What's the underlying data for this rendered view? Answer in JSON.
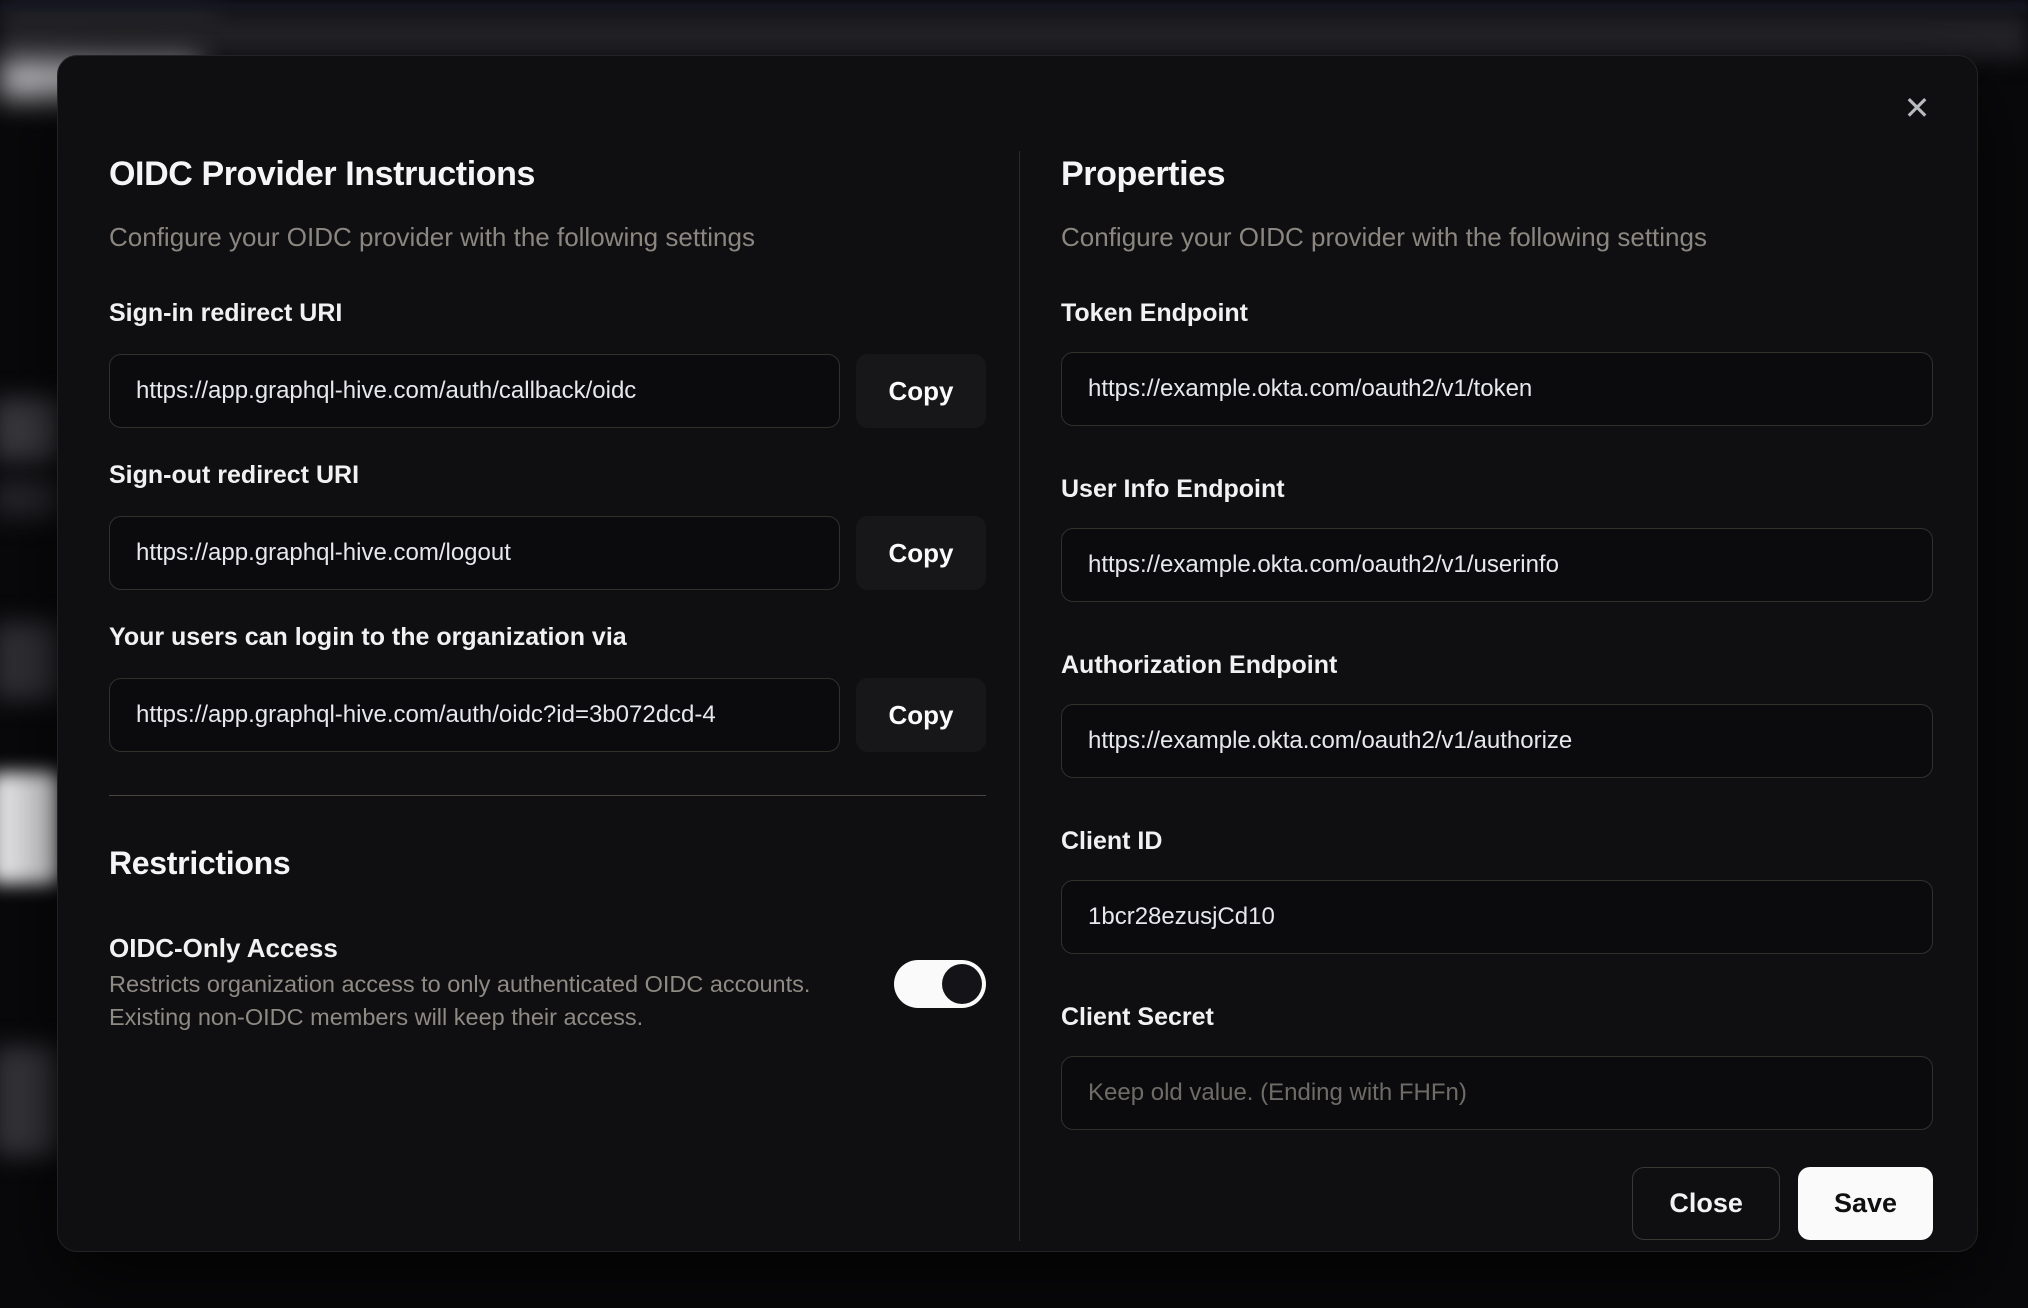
{
  "colors": {
    "modal_bg": "#0f0f12",
    "input_border": "#33302b",
    "accent_button_bg": "#fafafa",
    "toggle_on_track": "#fafafa",
    "toggle_on_knob": "#141418"
  },
  "modal": {
    "close_icon": "✕",
    "left": {
      "title": "OIDC Provider Instructions",
      "subtitle": "Configure your OIDC provider with the following settings",
      "fields": [
        {
          "label": "Sign-in redirect URI",
          "value": "https://app.graphql-hive.com/auth/callback/oidc",
          "copy_label": "Copy"
        },
        {
          "label": "Sign-out redirect URI",
          "value": "https://app.graphql-hive.com/logout",
          "copy_label": "Copy"
        },
        {
          "label": "Your users can login to the organization via",
          "value": "https://app.graphql-hive.com/auth/oidc?id=3b072dcd-4",
          "copy_label": "Copy"
        }
      ],
      "restrictions": {
        "title": "Restrictions",
        "toggle_label": "OIDC-Only Access",
        "toggle_description_line1": "Restricts organization access to only authenticated OIDC accounts.",
        "toggle_description_line2": "Existing non-OIDC members will keep their access.",
        "toggle_state": "on"
      }
    },
    "right": {
      "title": "Properties",
      "subtitle": "Configure your OIDC provider with the following settings",
      "fields": [
        {
          "label": "Token Endpoint",
          "value": "https://example.okta.com/oauth2/v1/token"
        },
        {
          "label": "User Info Endpoint",
          "value": "https://example.okta.com/oauth2/v1/userinfo"
        },
        {
          "label": "Authorization Endpoint",
          "value": "https://example.okta.com/oauth2/v1/authorize"
        },
        {
          "label": "Client ID",
          "value": "1bcr28ezusjCd10"
        },
        {
          "label": "Client Secret",
          "value": "",
          "placeholder": "Keep old value. (Ending with FHFn)"
        }
      ],
      "footer": {
        "close_label": "Close",
        "save_label": "Save"
      }
    }
  }
}
